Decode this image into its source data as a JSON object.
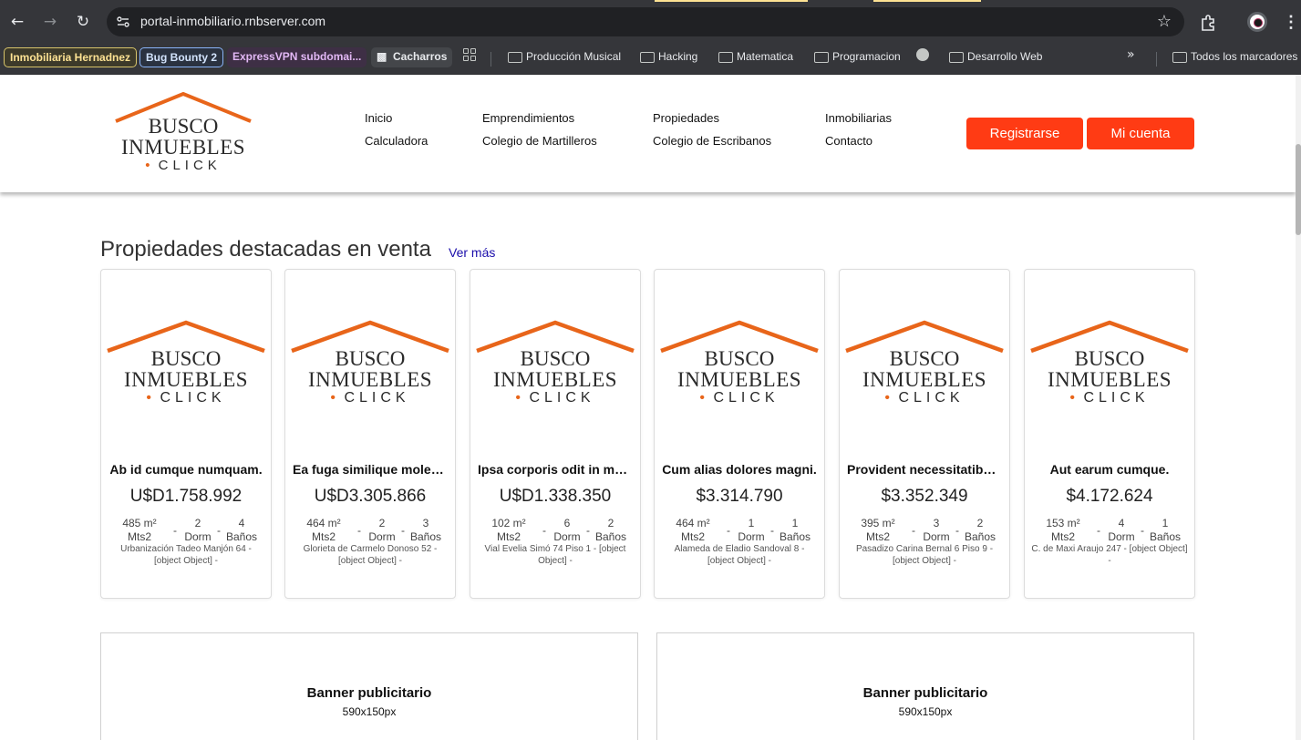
{
  "browser": {
    "url": "portal-inmobiliario.rnbserver.com",
    "bookmarks": {
      "chip1": "Inmobiliaria Hernadnez",
      "chip2": "Bug Bounty 2",
      "chip3": "ExpressVPN subdomai...",
      "chip4": "Cacharros",
      "folder1": "Producción Musical",
      "folder2": "Hacking",
      "folder3": "Matematica",
      "folder4": "Programacion",
      "folder5": "Desarrollo Web",
      "all": "Todos los marcadores"
    },
    "icons": [
      "back-icon",
      "forward-icon",
      "reload-icon",
      "site-info-icon",
      "star-icon",
      "extensions-icon",
      "profile-icon",
      "menu-icon",
      "apps-icon",
      "globe-icon",
      "folder-icon"
    ]
  },
  "header": {
    "logo": {
      "line1": "BUSCO",
      "line2": "INMUEBLES",
      "line3": "CLICK"
    },
    "nav": {
      "inicio": "Inicio",
      "calculadora": "Calculadora",
      "emprendimientos": "Emprendimientos",
      "martilleros": "Colegio de Martilleros",
      "propiedades": "Propiedades",
      "escribanos": "Colegio de Escribanos",
      "inmobiliarias": "Inmobiliarias",
      "contacto": "Contacto"
    },
    "register": "Registrarse",
    "account": "Mi cuenta"
  },
  "featured": {
    "title": "Propiedades destacadas en venta",
    "see_more": "Ver más",
    "units": {
      "area": "Mts2",
      "rooms": "Dorm",
      "baths": "Baños"
    },
    "cards": [
      {
        "title": "Ab id cumque numquam.",
        "price": "U$D1.758.992",
        "area": "485 m²",
        "rooms": "2",
        "baths": "4",
        "address": "Urbanización Tadeo Manjón 64 - [object Object] -"
      },
      {
        "title": "Ea fuga similique molestiae.",
        "price": "U$D3.305.866",
        "area": "464 m²",
        "rooms": "2",
        "baths": "3",
        "address": "Glorieta de Carmelo Donoso 52 - [object Object] -"
      },
      {
        "title": "Ipsa corporis odit in maxime.",
        "price": "U$D1.338.350",
        "area": "102 m²",
        "rooms": "6",
        "baths": "2",
        "address": "Vial Evelia Simó 74 Piso 1 - [object Object] -"
      },
      {
        "title": "Cum alias dolores magni.",
        "price": "$3.314.790",
        "area": "464 m²",
        "rooms": "1",
        "baths": "1",
        "address": "Alameda de Eladio Sandoval 8 - [object Object] -"
      },
      {
        "title": "Provident necessitatibus quos.",
        "price": "$3.352.349",
        "area": "395 m²",
        "rooms": "3",
        "baths": "2",
        "address": "Pasadizo Carina Bernal 6 Piso 9 - [object Object] -"
      },
      {
        "title": "Aut earum cumque.",
        "price": "$4.172.624",
        "area": "153 m²",
        "rooms": "4",
        "baths": "1",
        "address": "C. de Maxi Araujo 247 - [object Object] -"
      }
    ]
  },
  "banners": [
    {
      "title": "Banner publicitario",
      "size": "590x150px"
    },
    {
      "title": "Banner publicitario",
      "size": "590x150px"
    }
  ],
  "colors": {
    "brand_orange": "#e8651a",
    "cta_red": "#ff3b14",
    "chrome_dark": "#35363a",
    "omnibox": "#202124"
  }
}
